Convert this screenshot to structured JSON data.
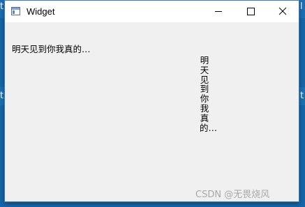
{
  "window": {
    "title": "Widget",
    "icon": "qt-window-icon"
  },
  "titlebar_buttons": {
    "minimize_icon": "minimize-icon",
    "maximize_icon": "maximize-icon",
    "close_icon": "close-icon"
  },
  "content": {
    "horizontal_label": "明天见到你我真的…",
    "vertical_label": "明天见到你我真的…"
  },
  "watermark": "CSDN @无畏烧风",
  "background_fragments": [
    "t",
    "l",
    "t",
    "t"
  ],
  "colors": {
    "desktop": "#1565a8",
    "window_bg": "#f0f0f0",
    "titlebar_bg": "#ffffff",
    "window_border": "#3a7bc0"
  }
}
